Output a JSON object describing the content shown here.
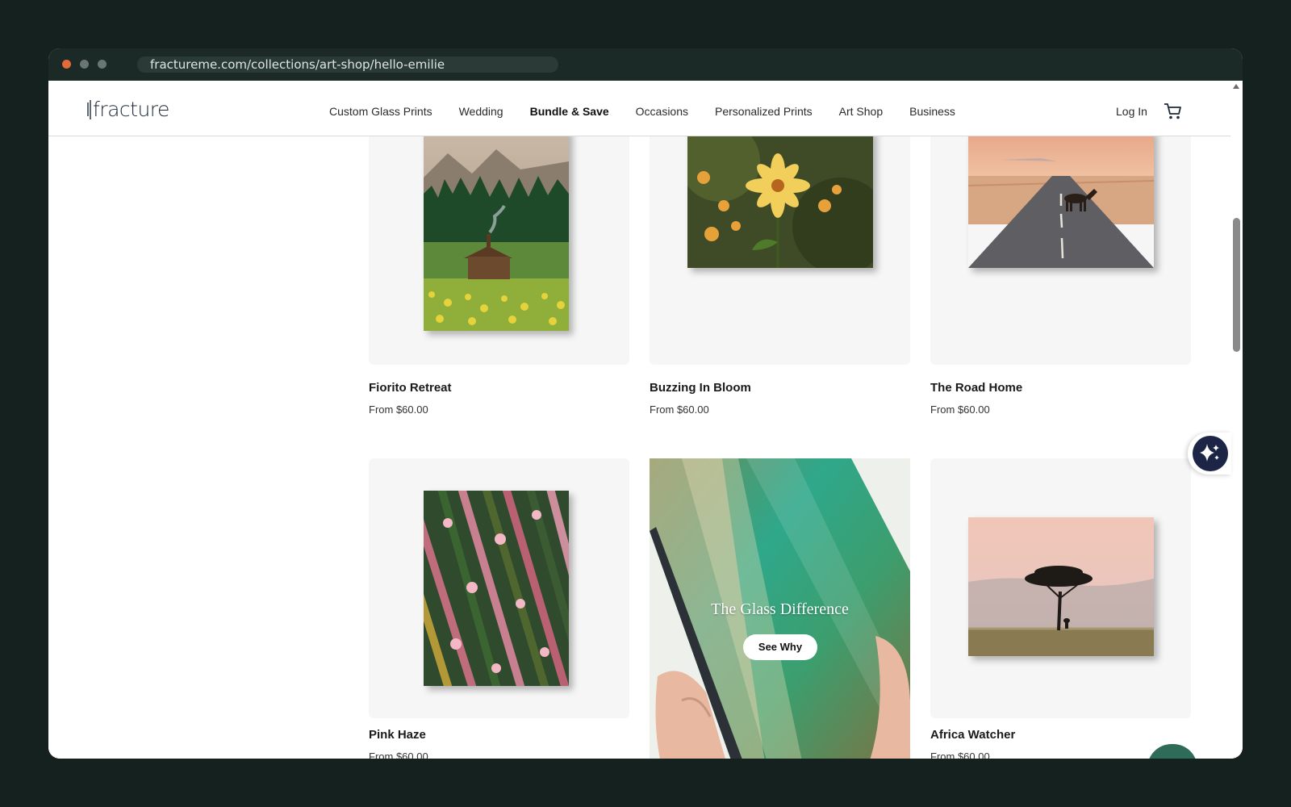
{
  "browser": {
    "url": "fractureme.com/collections/art-shop/hello-emilie"
  },
  "header": {
    "logo_text": "fracture",
    "nav": [
      {
        "label": "Custom Glass Prints"
      },
      {
        "label": "Wedding"
      },
      {
        "label": "Bundle & Save"
      },
      {
        "label": "Occasions"
      },
      {
        "label": "Personalized Prints"
      },
      {
        "label": "Art Shop"
      },
      {
        "label": "Business"
      }
    ],
    "login": "Log In",
    "cart_icon": "cart-icon"
  },
  "products": [
    {
      "title": "Fiorito Retreat",
      "price": "From $60.00"
    },
    {
      "title": "Buzzing In Bloom",
      "price": "From $60.00"
    },
    {
      "title": "The Road Home",
      "price": "From $60.00"
    },
    {
      "title": "Pink Haze",
      "price": "From $60.00"
    },
    {
      "title": "Africa Watcher",
      "price": "From $60.00"
    }
  ],
  "promo": {
    "heading": "The Glass Difference",
    "button": "See Why"
  },
  "widgets": {
    "ai_icon": "sparkle-icon",
    "chat_icon": "chat-icon"
  },
  "colors": {
    "page_background": "#14211e",
    "ai_button": "#1c2546",
    "chat_button": "#2e6b58"
  }
}
